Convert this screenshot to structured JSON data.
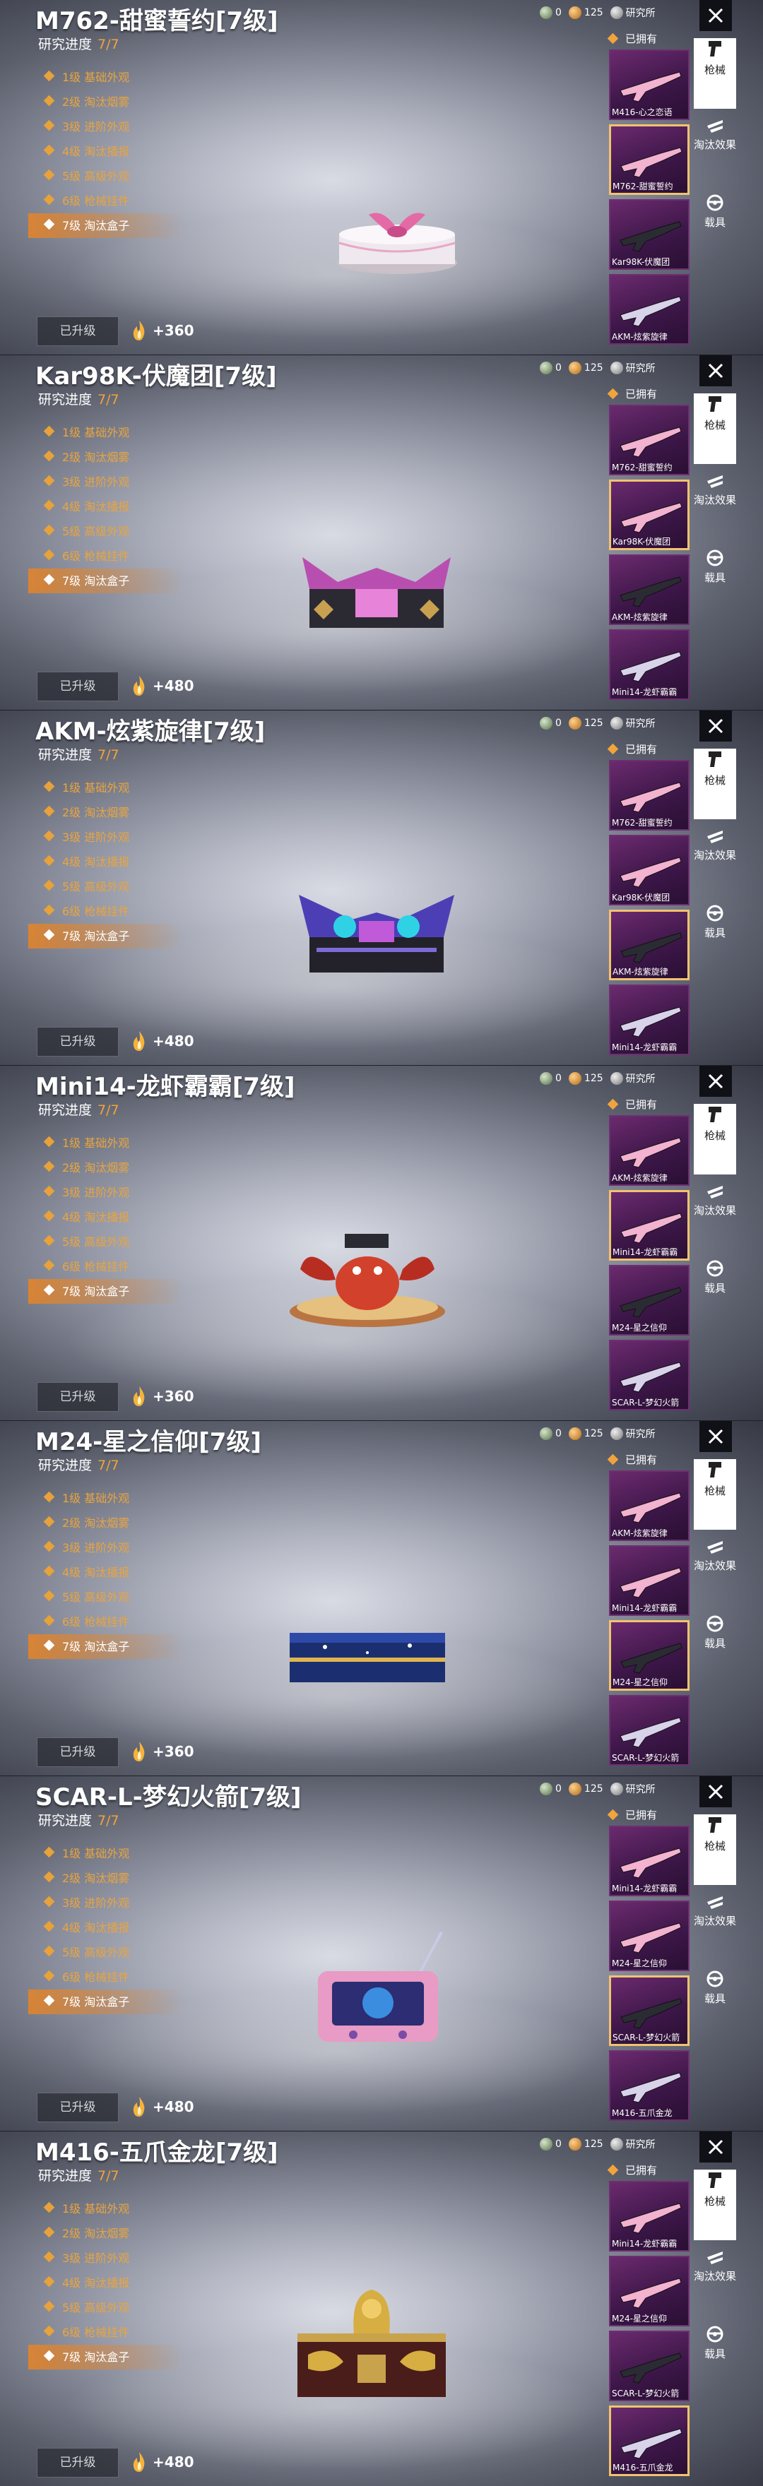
{
  "panels": [
    {
      "title": "M762-甜蜜誓约[7级]",
      "progress_label": "研究进度",
      "progress_value": "7/7",
      "stages": [
        "1级 基础外观",
        "2级 淘汰烟雾",
        "3级 进阶外观",
        "4级 淘汰播报",
        "5级 高级外观",
        "6级 枪械挂件",
        "7级 淘汰盒子"
      ],
      "upgrade_button": "已升级",
      "reward": "+360",
      "resources": {
        "a": "0",
        "b": "125",
        "c": "研究所"
      },
      "owned_label": "已拥有",
      "thumbs": [
        "M416-心之恋语",
        "M762-甜蜜誓约",
        "Kar98K-伏魔团",
        "AKM-炫紫旋律"
      ],
      "selected_thumb": 1,
      "object": "gift-box",
      "side_menu": [
        "枪械",
        "淘汰效果",
        "载具"
      ]
    },
    {
      "title": "Kar98K-伏魔团[7级]",
      "progress_label": "研究进度",
      "progress_value": "7/7",
      "stages": [
        "1级 基础外观",
        "2级 淘汰烟雾",
        "3级 进阶外观",
        "4级 淘汰播报",
        "5级 高级外观",
        "6级 枪械挂件",
        "7级 淘汰盒子"
      ],
      "upgrade_button": "已升级",
      "reward": "+480",
      "resources": {
        "a": "0",
        "b": "125",
        "c": "研究所"
      },
      "owned_label": "已拥有",
      "thumbs": [
        "M762-甜蜜誓约",
        "Kar98K-伏魔团",
        "AKM-炫紫旋律",
        "Mini14-龙虾霸霸"
      ],
      "selected_thumb": 1,
      "object": "spiked-chest",
      "side_menu": [
        "枪械",
        "淘汰效果",
        "载具"
      ]
    },
    {
      "title": "AKM-炫紫旋律[7级]",
      "progress_label": "研究进度",
      "progress_value": "7/7",
      "stages": [
        "1级 基础外观",
        "2级 淘汰烟雾",
        "3级 进阶外观",
        "4级 淘汰播报",
        "5级 高级外观",
        "6级 枪械挂件",
        "7级 淘汰盒子"
      ],
      "upgrade_button": "已升级",
      "reward": "+480",
      "resources": {
        "a": "0",
        "b": "125",
        "c": "研究所"
      },
      "owned_label": "已拥有",
      "thumbs": [
        "M762-甜蜜誓约",
        "Kar98K-伏魔团",
        "AKM-炫紫旋律",
        "Mini14-龙虾霸霸"
      ],
      "selected_thumb": 2,
      "object": "speaker-box",
      "side_menu": [
        "枪械",
        "淘汰效果",
        "载具"
      ]
    },
    {
      "title": "Mini14-龙虾霸霸[7级]",
      "progress_label": "研究进度",
      "progress_value": "7/7",
      "stages": [
        "1级 基础外观",
        "2级 淘汰烟雾",
        "3级 进阶外观",
        "4级 淘汰播报",
        "5级 高级外观",
        "6级 枪械挂件",
        "7级 淘汰盒子"
      ],
      "upgrade_button": "已升级",
      "reward": "+360",
      "resources": {
        "a": "0",
        "b": "125",
        "c": "研究所"
      },
      "owned_label": "已拥有",
      "thumbs": [
        "AKM-炫紫旋律",
        "Mini14-龙虾霸霸",
        "M24-星之信仰",
        "SCAR-L-梦幻火箭"
      ],
      "selected_thumb": 1,
      "object": "lobster-plate",
      "side_menu": [
        "枪械",
        "淘汰效果",
        "载具"
      ]
    },
    {
      "title": "M24-星之信仰[7级]",
      "progress_label": "研究进度",
      "progress_value": "7/7",
      "stages": [
        "1级 基础外观",
        "2级 淘汰烟雾",
        "3级 进阶外观",
        "4级 淘汰播报",
        "5级 高级外观",
        "6级 枪械挂件",
        "7级 淘汰盒子"
      ],
      "upgrade_button": "已升级",
      "reward": "+360",
      "resources": {
        "a": "0",
        "b": "125",
        "c": "研究所"
      },
      "owned_label": "已拥有",
      "thumbs": [
        "AKM-炫紫旋律",
        "Mini14-龙虾霸霸",
        "M24-星之信仰",
        "SCAR-L-梦幻火箭"
      ],
      "selected_thumb": 2,
      "object": "star-case",
      "side_menu": [
        "枪械",
        "淘汰效果",
        "载具"
      ]
    },
    {
      "title": "SCAR-L-梦幻火箭[7级]",
      "progress_label": "研究进度",
      "progress_value": "7/7",
      "stages": [
        "1级 基础外观",
        "2级 淘汰烟雾",
        "3级 进阶外观",
        "4级 淘汰播报",
        "5级 高级外观",
        "6级 枪械挂件",
        "7级 淘汰盒子"
      ],
      "upgrade_button": "已升级",
      "reward": "+480",
      "resources": {
        "a": "0",
        "b": "125",
        "c": "研究所"
      },
      "owned_label": "已拥有",
      "thumbs": [
        "Mini14-龙虾霸霸",
        "M24-星之信仰",
        "SCAR-L-梦幻火箭",
        "M416-五爪金龙"
      ],
      "selected_thumb": 2,
      "object": "tv-box",
      "side_menu": [
        "枪械",
        "淘汰效果",
        "载具"
      ]
    },
    {
      "title": "M416-五爪金龙[7级]",
      "progress_label": "研究进度",
      "progress_value": "7/7",
      "stages": [
        "1级 基础外观",
        "2级 淘汰烟雾",
        "3级 进阶外观",
        "4级 淘汰播报",
        "5级 高级外观",
        "6级 枪械挂件",
        "7级 淘汰盒子"
      ],
      "upgrade_button": "已升级",
      "reward": "+480",
      "resources": {
        "a": "0",
        "b": "125",
        "c": "研究所"
      },
      "owned_label": "已拥有",
      "thumbs": [
        "Mini14-龙虾霸霸",
        "M24-星之信仰",
        "SCAR-L-梦幻火箭",
        "M416-五爪金龙"
      ],
      "selected_thumb": 3,
      "object": "dragon-chest",
      "side_menu": [
        "枪械",
        "淘汰效果",
        "载具"
      ]
    }
  ],
  "colors": {
    "accent": "#f2a33a",
    "thumb_bg": "#3b1647",
    "selected_border": "#f2c36e"
  }
}
